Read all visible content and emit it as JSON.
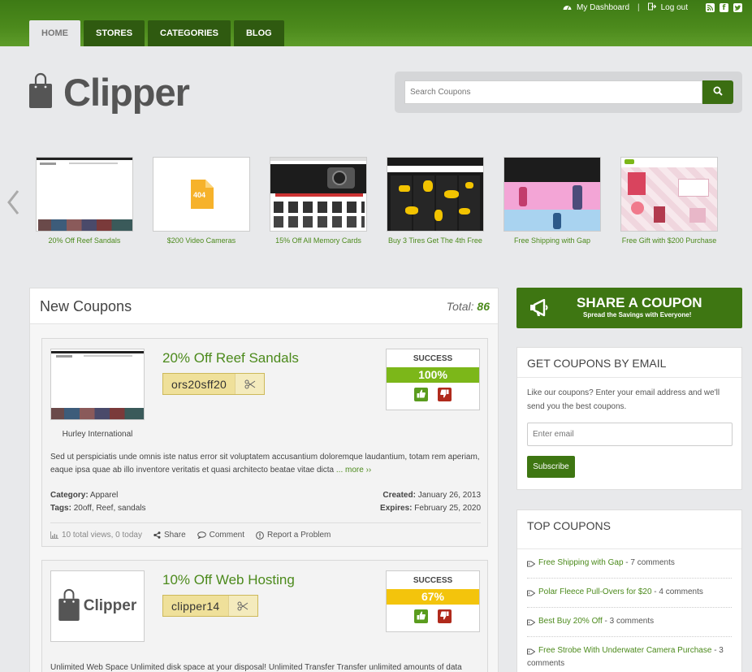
{
  "nav": {
    "tabs": [
      "HOME",
      "STORES",
      "CATEGORIES",
      "BLOG"
    ]
  },
  "toplinks": {
    "dashboard": "My Dashboard",
    "logout": "Log out"
  },
  "logo": {
    "text": "Clipper"
  },
  "search": {
    "placeholder": "Search Coupons"
  },
  "slider": [
    {
      "caption": "20% Off Reef Sandals",
      "thumb": "site"
    },
    {
      "caption": "$200 Video Cameras",
      "thumb": "404"
    },
    {
      "caption": "15% Off All Memory Cards",
      "thumb": "cameras"
    },
    {
      "caption": "Buy 3 Tires Get The 4th Free",
      "thumb": "map"
    },
    {
      "caption": "Free Shipping with Gap",
      "thumb": "gap"
    },
    {
      "caption": "Free Gift with $200 Purchase",
      "thumb": "gift"
    }
  ],
  "main": {
    "title": "New Coupons",
    "total_label": "Total:",
    "total": "86"
  },
  "coupons": [
    {
      "title": "20% Off Reef Sandals",
      "code": "ors20sff20",
      "store": "Hurley International",
      "success_label": "SUCCESS",
      "success": "100%",
      "success_value": 100,
      "success_color": "#7cb719",
      "desc": "Sed ut perspiciatis unde omnis iste natus error sit voluptatem accusantium doloremque laudantium, totam rem aperiam, eaque ipsa quae ab illo inventore veritatis et quasi architecto beatae vitae dicta",
      "more": "... more ››",
      "category_label": "Category:",
      "category": "Apparel",
      "tags_label": "Tags:",
      "tags": "20off, Reef, sandals",
      "created_label": "Created:",
      "created": "January 26, 2013",
      "expires_label": "Expires:",
      "expires": "February 25, 2020",
      "views": "10 total views, 0 today",
      "share": "Share",
      "comment": "Comment",
      "report": "Report a Problem"
    },
    {
      "title": "10% Off Web Hosting",
      "code": "clipper14",
      "store_logo": "Clipper",
      "success_label": "SUCCESS",
      "success": "67%",
      "success_value": 67,
      "success_color": "#f3c40c",
      "desc": "Unlimited Web Space Unlimited disk space at your disposal! Unlimited Transfer Transfer unlimited amounts of data"
    }
  ],
  "share": {
    "title": "SHARE A COUPON",
    "sub": "Spread the Savings with Everyone!"
  },
  "email_widget": {
    "title": "GET COUPONS BY EMAIL",
    "text": "Like our coupons? Enter your email address and we'll send you the best coupons.",
    "placeholder": "Enter email",
    "button": "Subscribe"
  },
  "top_coupons": {
    "title": "TOP COUPONS",
    "items": [
      {
        "link": "Free Shipping with Gap",
        "comments": "- 7 comments"
      },
      {
        "link": "Polar Fleece Pull-Overs for $20",
        "comments": "- 4 comments"
      },
      {
        "link": "Best Buy 20% Off",
        "comments": "- 3 comments"
      },
      {
        "link": "Free Strobe With Underwater Camera Purchase",
        "comments": "- 3 comments"
      }
    ]
  },
  "colors": {
    "brand": "#4c8a1c",
    "brand_dark": "#3e7612"
  }
}
